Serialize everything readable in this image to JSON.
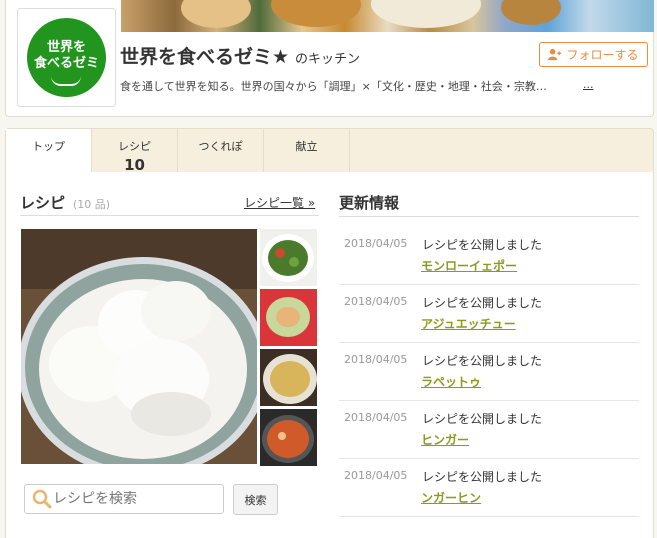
{
  "header": {
    "logo_text": [
      "世界を",
      "食べるゼミ"
    ],
    "title": "世界を食べるゼミ★",
    "title_suffix": "のキッチン",
    "description": "食を通して世界を知る。世界の国々から「調理」×「文化・歴史・地理・社会・宗教…",
    "more_label": "...",
    "follow_label": "フォローする"
  },
  "tabs": [
    {
      "label": "トップ",
      "count": ""
    },
    {
      "label": "レシピ",
      "count": "10"
    },
    {
      "label": "つくれぽ",
      "count": ""
    },
    {
      "label": "献立",
      "count": ""
    }
  ],
  "recipes": {
    "heading": "レシピ",
    "count_label": "(10 品)",
    "list_link": "レシピ一覧 »",
    "search_placeholder": "レシピを検索",
    "search_button": "検索"
  },
  "updates": {
    "heading": "更新情報",
    "items": [
      {
        "date": "2018/04/05",
        "message": "レシピを公開しました",
        "name": "モンローイェポー"
      },
      {
        "date": "2018/04/05",
        "message": "レシピを公開しました",
        "name": "アジュエッチュー"
      },
      {
        "date": "2018/04/05",
        "message": "レシピを公開しました",
        "name": "ラペットゥ"
      },
      {
        "date": "2018/04/05",
        "message": "レシピを公開しました",
        "name": "ヒンガー"
      },
      {
        "date": "2018/04/05",
        "message": "レシピを公開しました",
        "name": "ンガーヒン"
      }
    ]
  },
  "colors": {
    "accent_orange": "#f08a3c",
    "link_green": "#8a9a1b",
    "logo_green": "#22951f"
  }
}
